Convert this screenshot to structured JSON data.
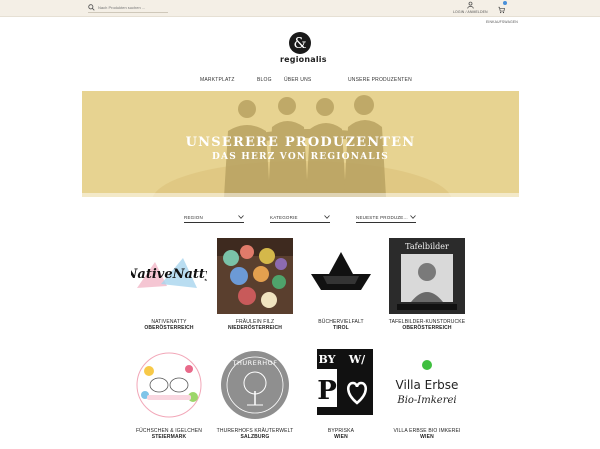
{
  "search": {
    "placeholder": "Nach Produkten suchen ..."
  },
  "topbar": {
    "account_label": "LOGIN / ANMELDEN",
    "cart_label": "EINKAUFSWAGEN"
  },
  "brand": {
    "mark": "&",
    "name": "regionalis"
  },
  "nav": [
    "MARKTPLATZ",
    "BLOG",
    "ÜBER UNS",
    "UNSERE PRODUZENTEN"
  ],
  "hero": {
    "title": "UNSERERE PRODUZENTEN",
    "subtitle": "DAS HERZ VON REGIONALIS"
  },
  "filters": [
    "REGION",
    "KATEGORIE",
    "NEUESTE PRODUZE..."
  ],
  "producers": [
    {
      "name": "NATIVENATTY",
      "region": "OBERÖSTERREICH",
      "logo_text": "NativeNatty"
    },
    {
      "name": "FRÄULEIN FILZ",
      "region": "NIEDERÖSTERREICH",
      "logo_text": ""
    },
    {
      "name": "BÜCHERVIELFALT",
      "region": "TIROL",
      "logo_text": ""
    },
    {
      "name": "TAFELBILDER-KUNSTDRUCKE",
      "region": "OBERÖSTERREICH",
      "logo_text": "Tafelbilder"
    },
    {
      "name": "FÜCHSCHEN & IGELCHEN",
      "region": "STEIERMARK",
      "logo_text": ""
    },
    {
      "name": "THURERHOFS KRÄUTERWELT",
      "region": "SALZBURG",
      "logo_text": "THURERHOF"
    },
    {
      "name": "BYPRISKA",
      "region": "WIEN",
      "logo_text": "BY W/ P"
    },
    {
      "name": "VILLA ERBSE BIO IMKEREI",
      "region": "WIEN",
      "logo_text_1": "Villa Erbse",
      "logo_text_2": "Bio-Imkerei"
    }
  ],
  "colors": {
    "topbar": "#f4efe6",
    "hero": "#e6d28f",
    "accent": "#1a1a1a",
    "green": "#3fbf3f"
  }
}
